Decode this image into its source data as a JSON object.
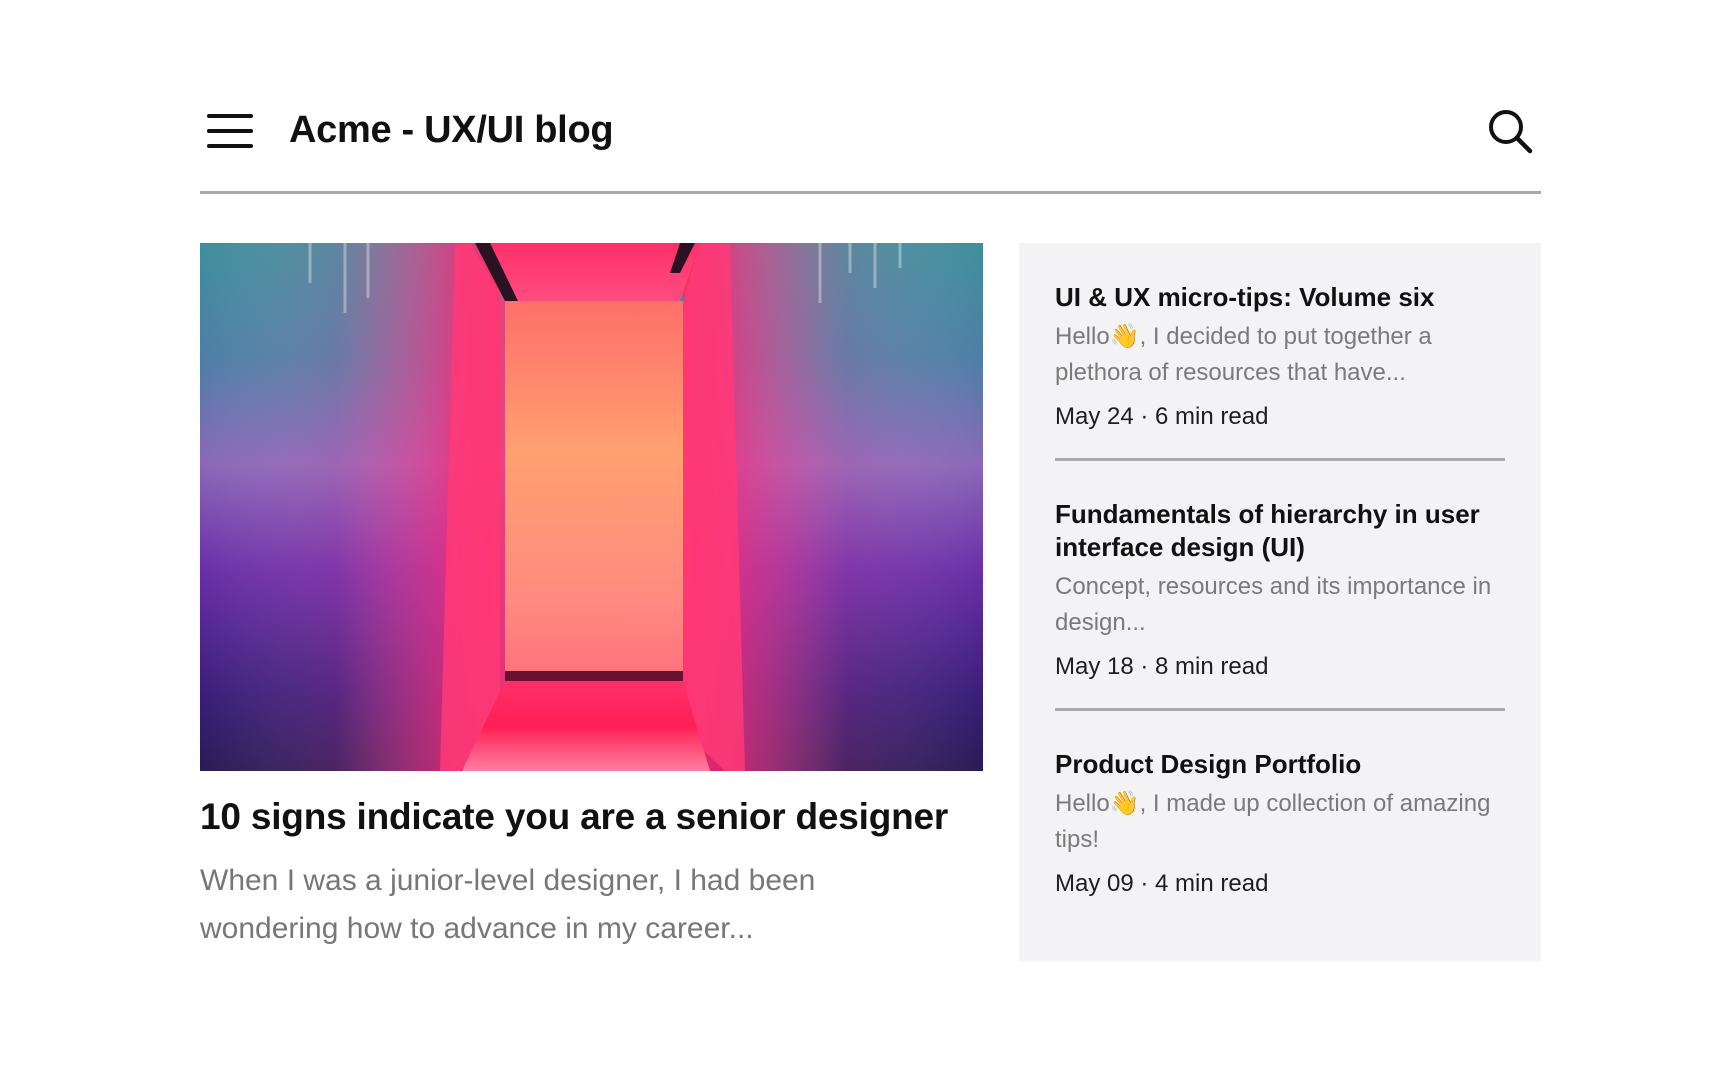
{
  "header": {
    "title": "Acme - UX/UI blog",
    "menu_icon": "hamburger-menu-icon",
    "search_icon": "search-icon"
  },
  "featured": {
    "image": "colorful-corridor-image",
    "title": "10 signs indicate you are a senior designer",
    "excerpt": "When I was a junior-level designer, I had been wondering how to advance in my career..."
  },
  "sidebar": {
    "posts": [
      {
        "title": "UI & UX micro-tips: Volume six",
        "excerpt": "Hello👋, I decided to put together a plethora of resources that have...",
        "meta": "May 24 · 6 min read"
      },
      {
        "title": "Fundamentals of hierarchy in user interface design (UI)",
        "excerpt": "Concept, resources and its importance in design...",
        "meta": "May 18 · 8 min read"
      },
      {
        "title": "Product Design Portfolio",
        "excerpt": "Hello👋, I made up collection of amazing tips!",
        "meta": "May 09 · 4 min read"
      }
    ]
  },
  "colors": {
    "text": "#111111",
    "muted": "#777777",
    "divider": "#a9a9a9",
    "sidebar_bg": "#f3f3f5"
  }
}
